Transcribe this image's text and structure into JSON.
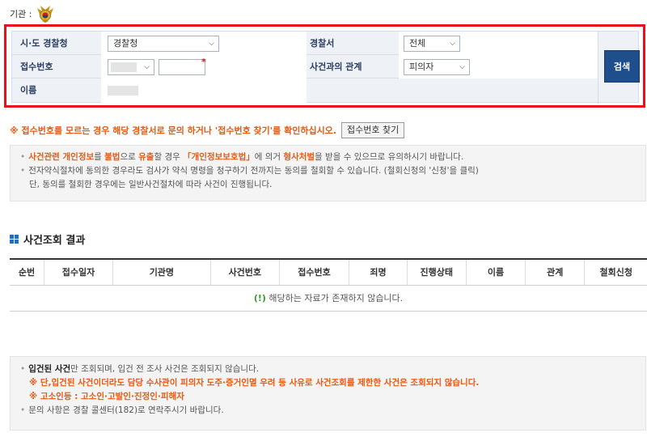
{
  "agency": {
    "label": "기관 :"
  },
  "search": {
    "province_label": "시·도 경찰청",
    "province_value": "경찰청",
    "station_label": "경찰서",
    "station_value": "전체",
    "receipt_label": "접수번호",
    "receipt_required_mark": "*",
    "relation_label": "사건과의 관계",
    "relation_value": "피의자",
    "name_label": "이름",
    "search_button": "검색"
  },
  "notice": {
    "text": "※ 접수번호를 모르는 경우 해당 경찰서로 문의 하거나 '접수번호 찾기'를 확인하십시오.",
    "find_button": "접수번호 찾기"
  },
  "info": {
    "line1_a": "사건관련 개인정보",
    "line1_b": "를 ",
    "line1_c": "불법",
    "line1_d": "으로 ",
    "line1_e": "유출",
    "line1_f": "할 경우 ",
    "line1_g": "「개인정보보호법」",
    "line1_h": "에 의거 ",
    "line1_i": "형사처벌",
    "line1_j": "을 받을 수 있으므로 유의하시기 바랍니다.",
    "line2": "전자약식절차에 동의한 경우라도 검사가 약식 명령을 청구하기 전까지는 동의를 철회할 수 있습니다. (철회신청의 '신청'을 클릭)",
    "line3": "단, 동의를 철회한 경우에는 일반사건절차에 따라 사건이 진행됩니다."
  },
  "results": {
    "title": "사건조회 결과",
    "columns": [
      "순번",
      "접수일자",
      "기관명",
      "사건번호",
      "접수번호",
      "죄명",
      "진행상태",
      "이름",
      "관계",
      "철회신청"
    ],
    "empty_icon": "(!)",
    "empty_text": " 해당하는 자료가 존재하지 않습니다."
  },
  "bottom": {
    "line1_a": "입건된 사건",
    "line1_b": "만 조회되며, 입건 전 조사 사건은 조회되지 않습니다.",
    "line2": "※ 단,입건된 사건이더라도 담당 수사관이 피의자 도주·증거인멸 우려 등 사유로 사건조회를 제한한 사건은 조회되지 않습니다.",
    "line3": "※ 고소인등 : 고소인·고발인·진정인·피해자",
    "line4": "문의 사항은 경찰 콜센터(182)로 연락주시기 바랍니다."
  },
  "colors": {
    "accent": "#e8101d",
    "button": "#1f4e8c",
    "notice": "#e85a12"
  }
}
